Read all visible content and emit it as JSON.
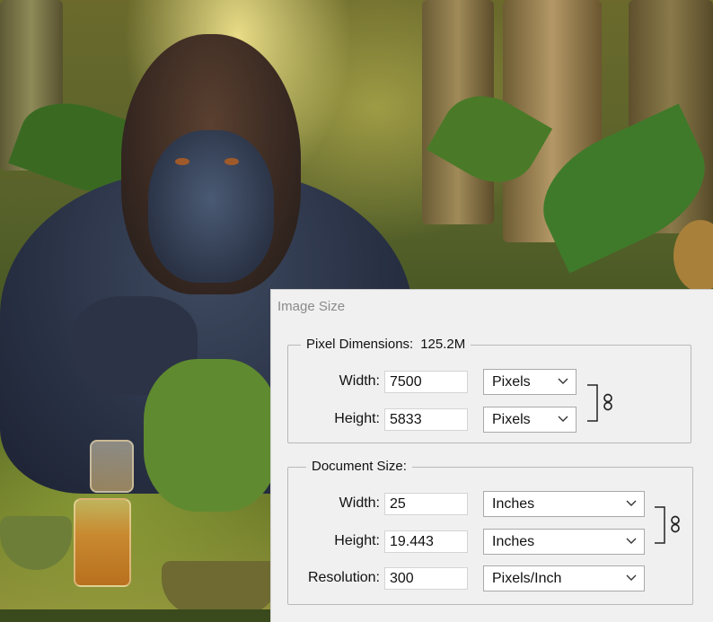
{
  "dialog": {
    "title": "Image Size",
    "pixel_dimensions": {
      "legend": "Pixel Dimensions:",
      "size": "125.2M",
      "width": {
        "label": "Width:",
        "value": "7500",
        "unit": "Pixels"
      },
      "height": {
        "label": "Height:",
        "value": "5833",
        "unit": "Pixels"
      }
    },
    "document_size": {
      "legend": "Document Size:",
      "width": {
        "label": "Width:",
        "value": "25",
        "unit": "Inches"
      },
      "height": {
        "label": "Height:",
        "value": "19.443",
        "unit": "Inches"
      },
      "resolution": {
        "label": "Resolution:",
        "value": "300",
        "unit": "Pixels/Inch"
      }
    }
  },
  "icons": {
    "link": "chain-link-icon",
    "dropdown": "chevron-down-icon"
  },
  "colors": {
    "dialog_bg": "#f0f0f0",
    "group_border": "#b9b9b9",
    "title_text": "#8a8a8a"
  }
}
